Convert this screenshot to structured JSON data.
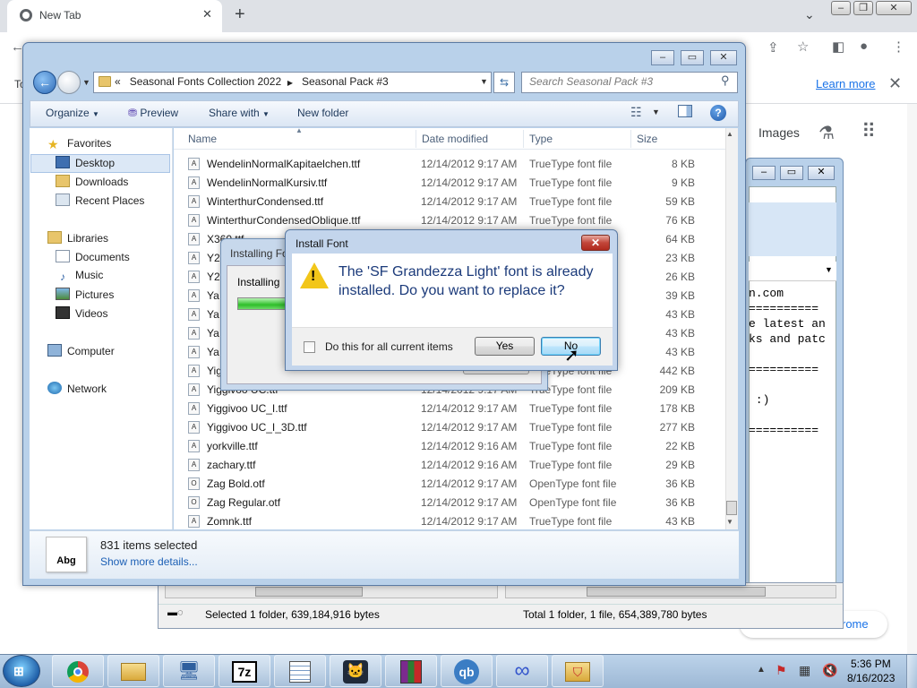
{
  "chrome": {
    "tab_title": "New Tab",
    "new_tab_symbol": "+",
    "infobar_left_fragment": "To",
    "learn_more": "Learn more",
    "images_link": "Images",
    "customize_fragment": "rome"
  },
  "background_window": {
    "text_lines": [
      "n.com",
      "==========",
      "e latest an",
      "ks and patc",
      "",
      "==========",
      "",
      " :)",
      "",
      "=========="
    ],
    "status_left": "Selected 1 folder, 639,184,916 bytes",
    "status_right": "Total 1 folder, 1 file, 654,389,780 bytes"
  },
  "explorer": {
    "breadcrumb_prefix": "«",
    "breadcrumb": [
      "Seasonal Fonts Collection 2022",
      "Seasonal Pack #3"
    ],
    "search_placeholder": "Search Seasonal Pack #3",
    "toolbar": {
      "organize": "Organize",
      "preview": "Preview",
      "share_with": "Share with",
      "new_folder": "New folder"
    },
    "nav": {
      "favorites": "Favorites",
      "desktop": "Desktop",
      "downloads": "Downloads",
      "recent_places": "Recent Places",
      "libraries": "Libraries",
      "documents": "Documents",
      "music": "Music",
      "pictures": "Pictures",
      "videos": "Videos",
      "computer": "Computer",
      "network": "Network"
    },
    "columns": {
      "name": "Name",
      "date": "Date modified",
      "type": "Type",
      "size": "Size"
    },
    "files": [
      {
        "name": "WendelinNormalKapitaelchen.ttf",
        "date": "12/14/2012 9:17 AM",
        "type": "TrueType font file",
        "size": "8 KB"
      },
      {
        "name": "WendelinNormalKursiv.ttf",
        "date": "12/14/2012 9:17 AM",
        "type": "TrueType font file",
        "size": "9 KB"
      },
      {
        "name": "WinterthurCondensed.ttf",
        "date": "12/14/2012 9:17 AM",
        "type": "TrueType font file",
        "size": "59 KB"
      },
      {
        "name": "WinterthurCondensedOblique.ttf",
        "date": "12/14/2012 9:17 AM",
        "type": "TrueType font file",
        "size": "76 KB"
      },
      {
        "name": "X360.ttf",
        "date": "",
        "type": "",
        "size": "64 KB"
      },
      {
        "name": "Y2",
        "date": "",
        "type": "",
        "size": "23 KB"
      },
      {
        "name": "Y2",
        "date": "",
        "type": "",
        "size": "26 KB"
      },
      {
        "name": "Ya",
        "date": "",
        "type": "",
        "size": "39 KB"
      },
      {
        "name": "Ya",
        "date": "",
        "type": "",
        "size": "43 KB"
      },
      {
        "name": "Ya",
        "date": "",
        "type": "",
        "size": "43 KB"
      },
      {
        "name": "Ya",
        "date": "",
        "type": "",
        "size": "43 KB"
      },
      {
        "name": "Yig",
        "date": "",
        "type": "TrueType font file",
        "size": "442 KB"
      },
      {
        "name": "Yiggivoo UC.ttf",
        "date": "12/14/2012 9:17 AM",
        "type": "TrueType font file",
        "size": "209 KB"
      },
      {
        "name": "Yiggivoo UC_I.ttf",
        "date": "12/14/2012 9:17 AM",
        "type": "TrueType font file",
        "size": "178 KB"
      },
      {
        "name": "Yiggivoo UC_I_3D.ttf",
        "date": "12/14/2012 9:17 AM",
        "type": "TrueType font file",
        "size": "277 KB"
      },
      {
        "name": "yorkville.ttf",
        "date": "12/14/2012 9:16 AM",
        "type": "TrueType font file",
        "size": "22 KB"
      },
      {
        "name": "zachary.ttf",
        "date": "12/14/2012 9:16 AM",
        "type": "TrueType font file",
        "size": "29 KB"
      },
      {
        "name": "Zag Bold.otf",
        "date": "12/14/2012 9:17 AM",
        "type": "OpenType font file",
        "size": "36 KB"
      },
      {
        "name": "Zag Regular.otf",
        "date": "12/14/2012 9:17 AM",
        "type": "OpenType font file",
        "size": "36 KB"
      },
      {
        "name": "Zomnk.ttf",
        "date": "12/14/2012 9:17 AM",
        "type": "TrueType font file",
        "size": "43 KB"
      }
    ],
    "details": {
      "thumb_text": "Abg",
      "count": "831 items selected",
      "show_more": "Show more details..."
    }
  },
  "installing": {
    "title": "Installing Fo",
    "label": "Installing"
  },
  "dialog": {
    "title": "Install Font",
    "message": "The 'SF Grandezza Light' font is already installed. Do you want to replace it?",
    "checkbox_label": "Do this for all current items",
    "yes": "Yes",
    "no": "No"
  },
  "taskbar": {
    "time": "5:36 PM",
    "date": "8/16/2023",
    "apps": [
      "chrome-icon",
      "explorer-icon",
      "remote-icon",
      "7zip-icon",
      "notepad-icon",
      "cat-icon",
      "winrar-icon",
      "qbittorrent-icon",
      "infinity-icon",
      "shield-folder-icon"
    ],
    "sevenzip_label": "7z",
    "qb_label": "qb"
  }
}
